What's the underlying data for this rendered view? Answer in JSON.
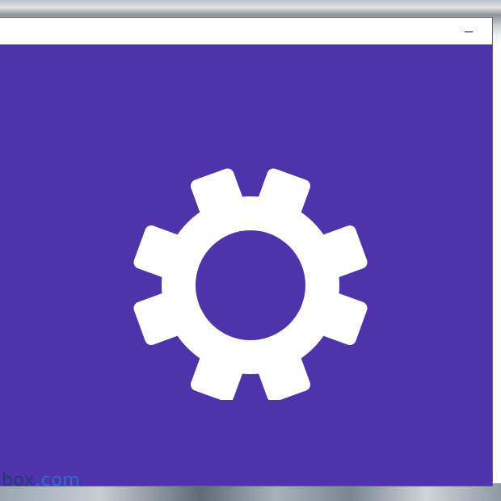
{
  "window": {
    "controls": {
      "minimize_icon": "minimize-icon"
    }
  },
  "splash": {
    "background_color": "#4f33aa",
    "icon": "gear-icon",
    "icon_color": "#ffffff"
  },
  "watermark": {
    "left_text": "box",
    "right_text": ".com"
  }
}
